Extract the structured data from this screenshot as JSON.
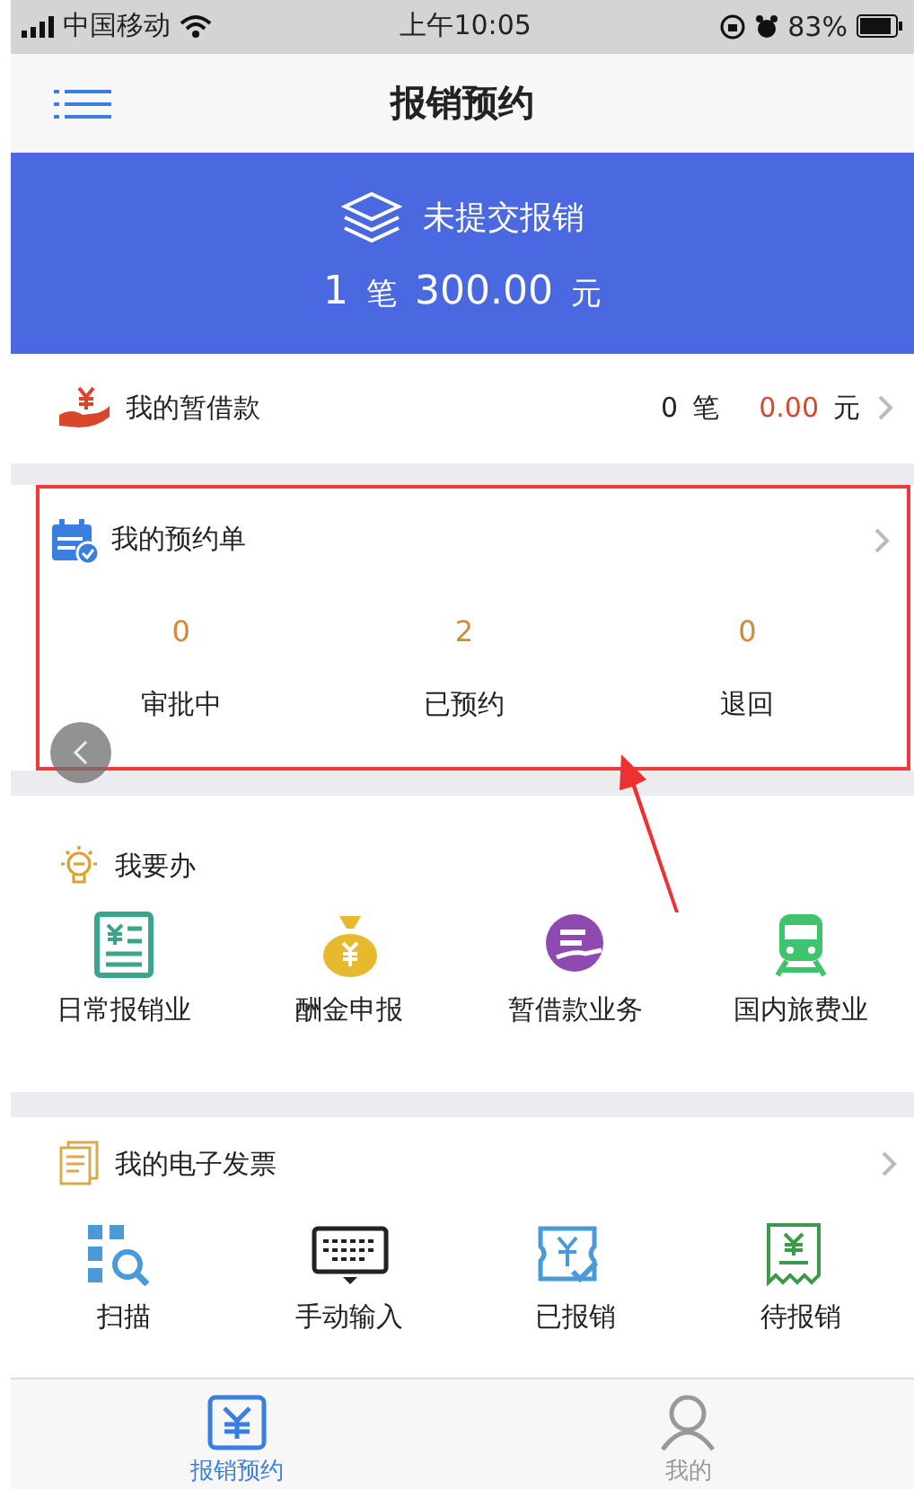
{
  "status_bar": {
    "carrier": "中国移动",
    "time": "上午10:05",
    "battery": "83%"
  },
  "nav": {
    "title": "报销预约"
  },
  "banner": {
    "label": "未提交报销",
    "count": "1",
    "count_unit": "笔",
    "amount": "300.00",
    "amount_unit": "元"
  },
  "loan": {
    "label": "我的暂借款",
    "count": "0",
    "count_unit": "笔",
    "amount": "0.00",
    "amount_unit": "元"
  },
  "reservations": {
    "title": "我的预约单",
    "highlighted": true,
    "stats": [
      {
        "value": "0",
        "label": "审批中"
      },
      {
        "value": "2",
        "label": "已预约"
      },
      {
        "value": "0",
        "label": "退回"
      }
    ]
  },
  "todo": {
    "title": "我要办",
    "items": [
      {
        "label": "日常报销业"
      },
      {
        "label": "酬金申报"
      },
      {
        "label": "暂借款业务"
      },
      {
        "label": "国内旅费业"
      }
    ]
  },
  "invoices": {
    "title": "我的电子发票",
    "items": [
      {
        "label": "扫描"
      },
      {
        "label": "手动输入"
      },
      {
        "label": "已报销"
      },
      {
        "label": "待报销"
      }
    ]
  },
  "tab_bar": [
    {
      "label": "报销预约",
      "selected": true
    },
    {
      "label": "我的",
      "selected": false
    }
  ]
}
